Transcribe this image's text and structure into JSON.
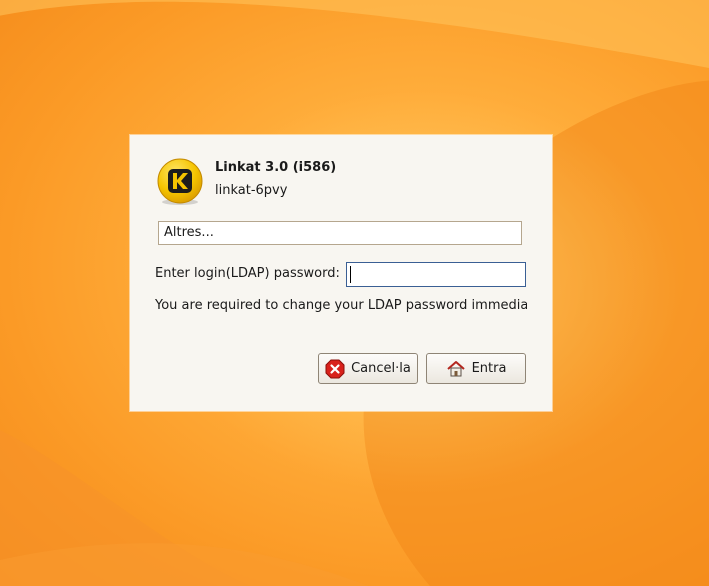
{
  "dialog": {
    "app_title": "Linkat 3.0 (i586)",
    "host_name": "linkat-6pvy",
    "session_combo": "Altres...",
    "password_label": "Enter login(LDAP) password:",
    "password_value": "",
    "message": "You are required to change your LDAP password immediately (password aged)",
    "cancel_label": "Cancel·la",
    "login_label": "Entra"
  },
  "icons": {
    "logo": "linkat-k-logo-icon",
    "cancel": "cancel-icon",
    "login": "home-icon"
  },
  "colors": {
    "background_orange": "#fb9a26",
    "dialog_bg": "#f8f6f1",
    "logo_yellow": "#f5c400",
    "cancel_red": "#d8211b"
  }
}
